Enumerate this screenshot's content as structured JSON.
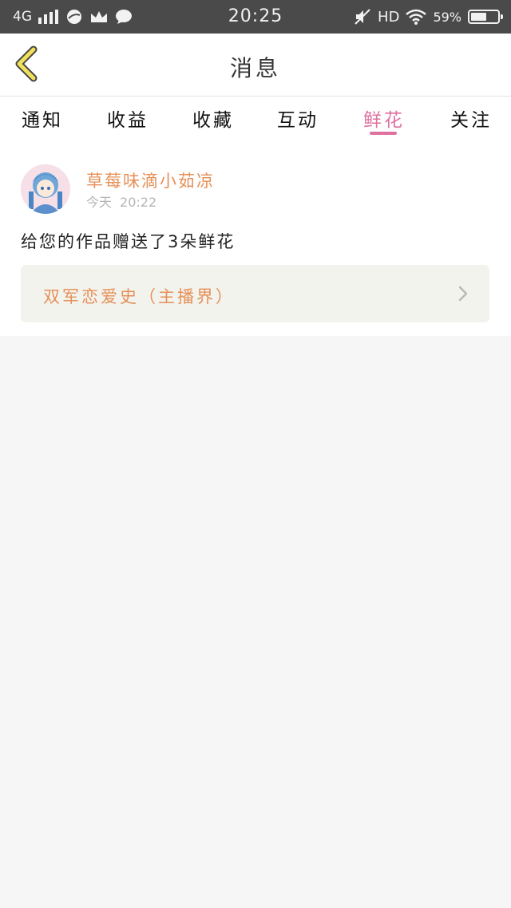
{
  "status_bar": {
    "network": "4G",
    "time": "20:25",
    "hd": "HD",
    "battery": "59%",
    "battery_level": 0.59
  },
  "header": {
    "title": "消息"
  },
  "tabs": [
    {
      "label": "通知",
      "active": false
    },
    {
      "label": "收益",
      "active": false
    },
    {
      "label": "收藏",
      "active": false
    },
    {
      "label": "互动",
      "active": false
    },
    {
      "label": "鲜花",
      "active": true
    },
    {
      "label": "关注",
      "active": false
    }
  ],
  "notification": {
    "username": "草莓味滴小茹凉",
    "day": "今天",
    "time": "20:22",
    "message": "给您的作品赠送了3朵鲜花",
    "work_title": "双军恋爱史（主播界）"
  },
  "colors": {
    "accent": "#e0709f",
    "username": "#e69058",
    "status_bar": "#4a4a4a",
    "back_arrow": "#f0e05a"
  }
}
